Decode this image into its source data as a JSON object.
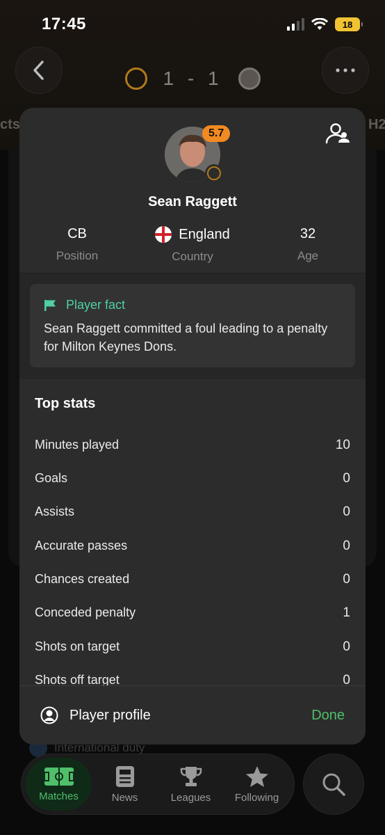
{
  "status": {
    "time": "17:45",
    "battery": "18"
  },
  "match": {
    "score": "1 - 1",
    "tab_left": "cts",
    "tab_right": "H2"
  },
  "player": {
    "name": "Sean Raggett",
    "rating": "5.7",
    "position": {
      "value": "CB",
      "label": "Position"
    },
    "country": {
      "value": "England",
      "label": "Country"
    },
    "age": {
      "value": "32",
      "label": "Age"
    }
  },
  "fact": {
    "title": "Player fact",
    "text": "Sean Raggett committed a foul leading to a penalty for Milton Keynes Dons."
  },
  "top_stats": {
    "title": "Top stats",
    "rows": [
      {
        "label": "Minutes played",
        "value": "10"
      },
      {
        "label": "Goals",
        "value": "0"
      },
      {
        "label": "Assists",
        "value": "0"
      },
      {
        "label": "Accurate passes",
        "value": "0"
      },
      {
        "label": "Chances created",
        "value": "0"
      },
      {
        "label": "Conceded penalty",
        "value": "1"
      },
      {
        "label": "Shots on target",
        "value": "0"
      },
      {
        "label": "Shots off target",
        "value": "0"
      }
    ]
  },
  "footer": {
    "profile_label": "Player profile",
    "done_label": "Done"
  },
  "background": {
    "international_duty": "International duty"
  },
  "nav": {
    "items": [
      {
        "label": "Matches",
        "icon": "pitch-icon"
      },
      {
        "label": "News",
        "icon": "news-icon"
      },
      {
        "label": "Leagues",
        "icon": "trophy-icon"
      },
      {
        "label": "Following",
        "icon": "star-icon"
      }
    ],
    "search_icon": "search-icon"
  },
  "colors": {
    "accent_green": "#4fbf6a",
    "fact_teal": "#4fd0a4",
    "rating_orange": "#f28a22"
  }
}
